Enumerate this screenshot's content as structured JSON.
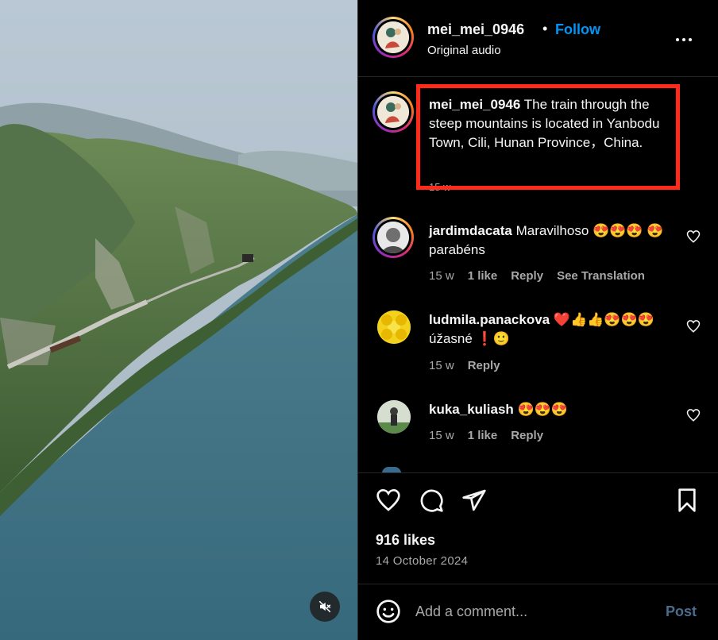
{
  "post": {
    "username": "mei_mei_0946",
    "separator": "•",
    "follow_label": "Follow",
    "audio_label": "Original audio",
    "more_icon": "more-horizontal-icon"
  },
  "caption": {
    "username": "mei_mei_0946",
    "text": "The train through the steep mountains is located in Yanbodu Town, Cili, Hunan Province，China.",
    "time": "15 w"
  },
  "comments": [
    {
      "username": "jardimdacata",
      "text": "Maravilhoso 😍😍😍 😍parabéns",
      "time": "15 w",
      "likes": "1 like",
      "reply": "Reply",
      "translate": "See Translation"
    },
    {
      "username": "ludmila.panackova",
      "text": "❤️👍👍😍😍😍 úžasné ❗🙂",
      "time": "15 w",
      "reply": "Reply"
    },
    {
      "username": "kuka_kuliash",
      "text": "😍😍😍",
      "time": "15 w",
      "likes": "1 like",
      "reply": "Reply"
    }
  ],
  "stats": {
    "likes": "916 likes",
    "date": "14 October 2024"
  },
  "composer": {
    "placeholder": "Add a comment...",
    "post_label": "Post"
  },
  "colors": {
    "background": "#000000",
    "accent_blue": "#0095f6",
    "muted_text": "#a8a8a8",
    "highlight_box": "#ff2a1a"
  }
}
